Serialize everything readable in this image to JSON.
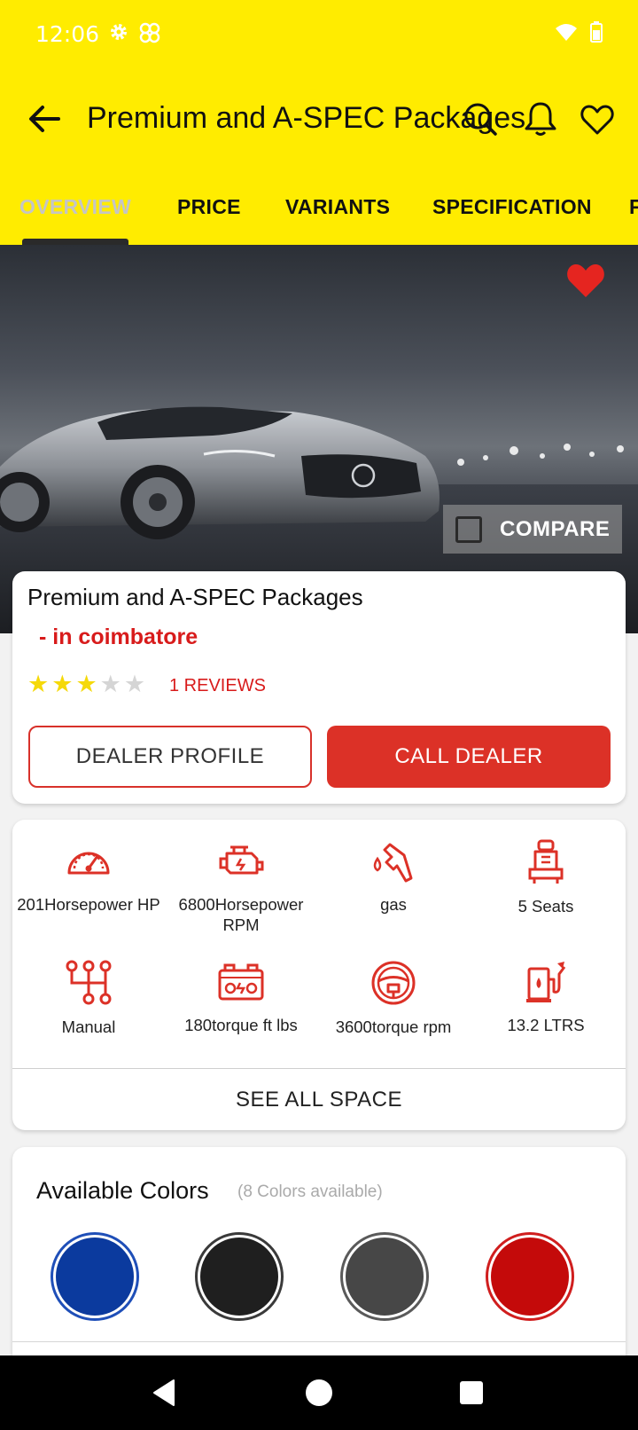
{
  "status_bar": {
    "time": "12:06"
  },
  "header": {
    "title": "Premium and A-SPEC Packages"
  },
  "tabs": [
    {
      "label": "OVERVIEW",
      "active": true
    },
    {
      "label": "PRICE",
      "active": false
    },
    {
      "label": "VARIANTS",
      "active": false
    },
    {
      "label": "SPECIFICATION",
      "active": false
    },
    {
      "label": "F",
      "active": false
    }
  ],
  "hero": {
    "compare_label": "COMPARE",
    "favorite": true
  },
  "summary": {
    "name": "Premium and A-SPEC Packages",
    "city": "- in coimbatore",
    "rating": 3,
    "rating_max": 5,
    "reviews": "1 REVIEWS",
    "dealer_profile_label": "DEALER PROFILE",
    "call_dealer_label": "CALL DEALER"
  },
  "specs": [
    {
      "icon": "speedometer-icon",
      "label": "201Horsepower HP"
    },
    {
      "icon": "engine-icon",
      "label": "6800Horsepower RPM"
    },
    {
      "icon": "fuel-nozzle-icon",
      "label": "gas"
    },
    {
      "icon": "car-seat-icon",
      "label": "5 Seats"
    },
    {
      "icon": "gear-shift-icon",
      "label": "Manual"
    },
    {
      "icon": "battery-icon",
      "label": "180torque ft lbs"
    },
    {
      "icon": "steering-wheel-icon",
      "label": "3600torque rpm"
    },
    {
      "icon": "fuel-station-icon",
      "label": "13.2 LTRS"
    }
  ],
  "see_all_label": "SEE ALL SPACE",
  "colors": {
    "title": "Available Colors",
    "subtitle": "(8 Colors available)",
    "swatches": [
      {
        "fill": "#0b3a9e",
        "ring": "#1f4fb8"
      },
      {
        "fill": "#1f1f1f",
        "ring": "#3a3a3a"
      },
      {
        "fill": "#474747",
        "ring": "#5a5a5a"
      },
      {
        "fill": "#c40a0a",
        "ring": "#d01e1e"
      }
    ]
  },
  "theme": {
    "accent": "#ffec00",
    "red": "#dc3127"
  }
}
